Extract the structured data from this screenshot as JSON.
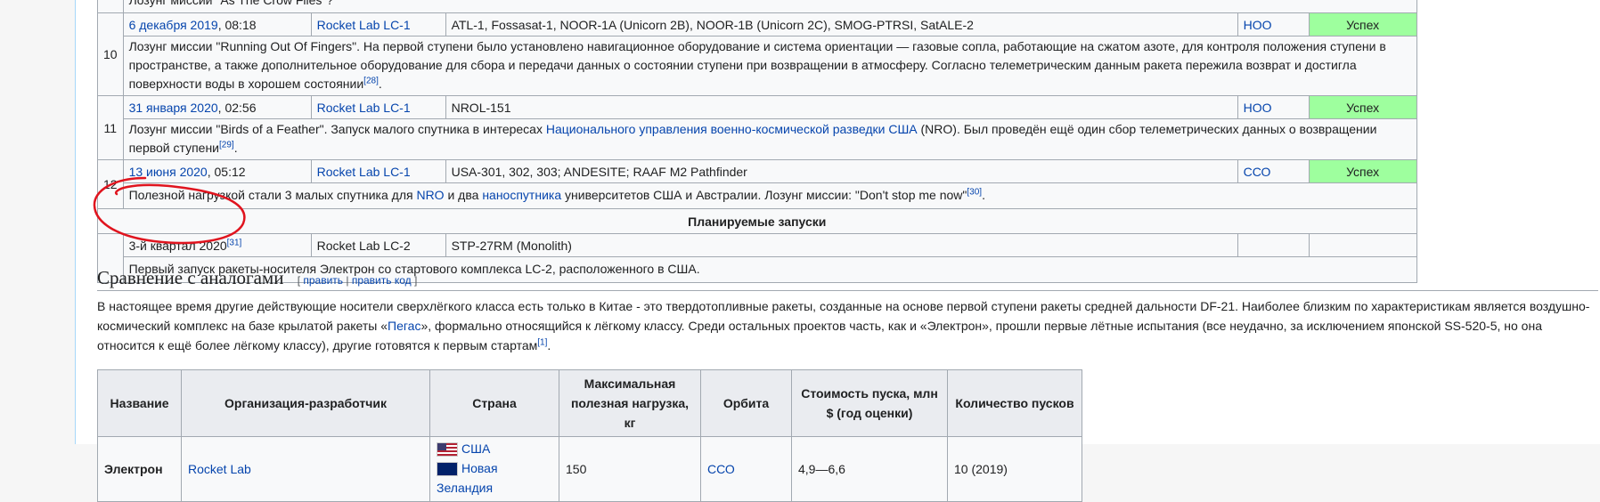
{
  "rows": [
    {
      "desc_line": "Лозунг миссии \"As The Crow Flies\"?"
    },
    {
      "num": "10",
      "date": "6 декабря 2019",
      "time": ", 08:18",
      "site": "Rocket Lab LC-1",
      "payload": "ATL-1, Fossasat-1, NOOR-1A (Unicorn 2B), NOOR-1B (Unicorn 2C), SMOG-PTRSI, SatALE-2",
      "orbit": "НОО",
      "result": "Успех",
      "desc": "Лозунг миссии \"Running Out Of Fingers\". На первой ступени было установлено навигационное оборудование и система ориентации — газовые сопла, работающие на сжатом азоте, для контроля положения ступени в пространстве, а также дополнительное оборудование для сбора и передачи данных о состоянии ступени при возвращении в атмосферу. Согласно телеметрическим данным ракета пережила возврат и достигла поверхности воды в хорошем состоянии",
      "ref": "[28]"
    },
    {
      "num": "11",
      "date": "31 января 2020",
      "time": ", 02:56",
      "site": "Rocket Lab LC-1",
      "payload": "NROL-151",
      "orbit": "НОО",
      "result": "Успех",
      "desc_a": "Лозунг миссии \"Birds of a Feather\". Запуск малого спутника в интересах ",
      "desc_link": "Национального управления военно-космической разведки США",
      "desc_b": " (NRO). Был проведён ещё один сбор телеметрических данных о возвращении первой ступени",
      "ref": "[29]"
    },
    {
      "num": "12",
      "date": "13 июня 2020",
      "time": ", 05:12",
      "site": "Rocket Lab LC-1",
      "payload": "USA-301, 302, 303; ANDESITE; RAAF M2 Pathfinder",
      "orbit": "ССО",
      "result": "Успех",
      "desc_a": "Полезной нагрузкой стали 3 малых спутника для ",
      "desc_link1": "NRO",
      "desc_b": " и два ",
      "desc_link2": "наноспутника",
      "desc_c": " университетов США и Австралии. Лозунг миссии: \"Don't stop me now\"",
      "ref": "[30]"
    }
  ],
  "planned": {
    "title": "Планируемые запуски",
    "date": "3-й квартал 2020",
    "ref": "[31]",
    "site": "Rocket Lab LC-2",
    "payload": "STP-27RM (Monolith)",
    "desc": "Первый запуск ракеты-носителя Электрон со стартового комплекса LC-2, расположенного в США."
  },
  "section": {
    "title": "Сравнение с аналогами",
    "edit": "править",
    "edit_code": "править код"
  },
  "paragraph": {
    "a": "В настоящее время другие действующие носители сверхлёгкого класса есть только в Китае - это твердотопливные ракеты, созданные на основе первой ступени ракеты средней дальности DF-21. Наиболее близким по характеристикам является воздушно-космический комплекс на базе крылатой ракеты «",
    "link": "Пегас",
    "b": "», формально относящийся к лёгкому классу. Среди остальных проектов часть, как и «Электрон», прошли первые лётные испытания (все неудачно, за исключением японской SS-520-5, но она относится к ещё более лёгкому классу), другие готовятся к первым стартам",
    "ref": "[1]",
    "end": "."
  },
  "compare": {
    "headers": [
      "Название",
      "Организация-разработчик",
      "Страна",
      "Максимальная полезная нагрузка, кг",
      "Орбита",
      "Стоимость пуска, млн $ (год оценки)",
      "Количество пусков"
    ],
    "row": {
      "name": "Электрон",
      "org": "Rocket Lab",
      "country1": "США",
      "country2": "Новая Зеландия",
      "payload": "150",
      "orbit": "ССО",
      "cost": "4,9—6,6",
      "launches": "10 (2019)"
    }
  },
  "colors": {
    "success": "#9eff9e",
    "link": "#0645ad",
    "annotation": "#e0141e"
  }
}
